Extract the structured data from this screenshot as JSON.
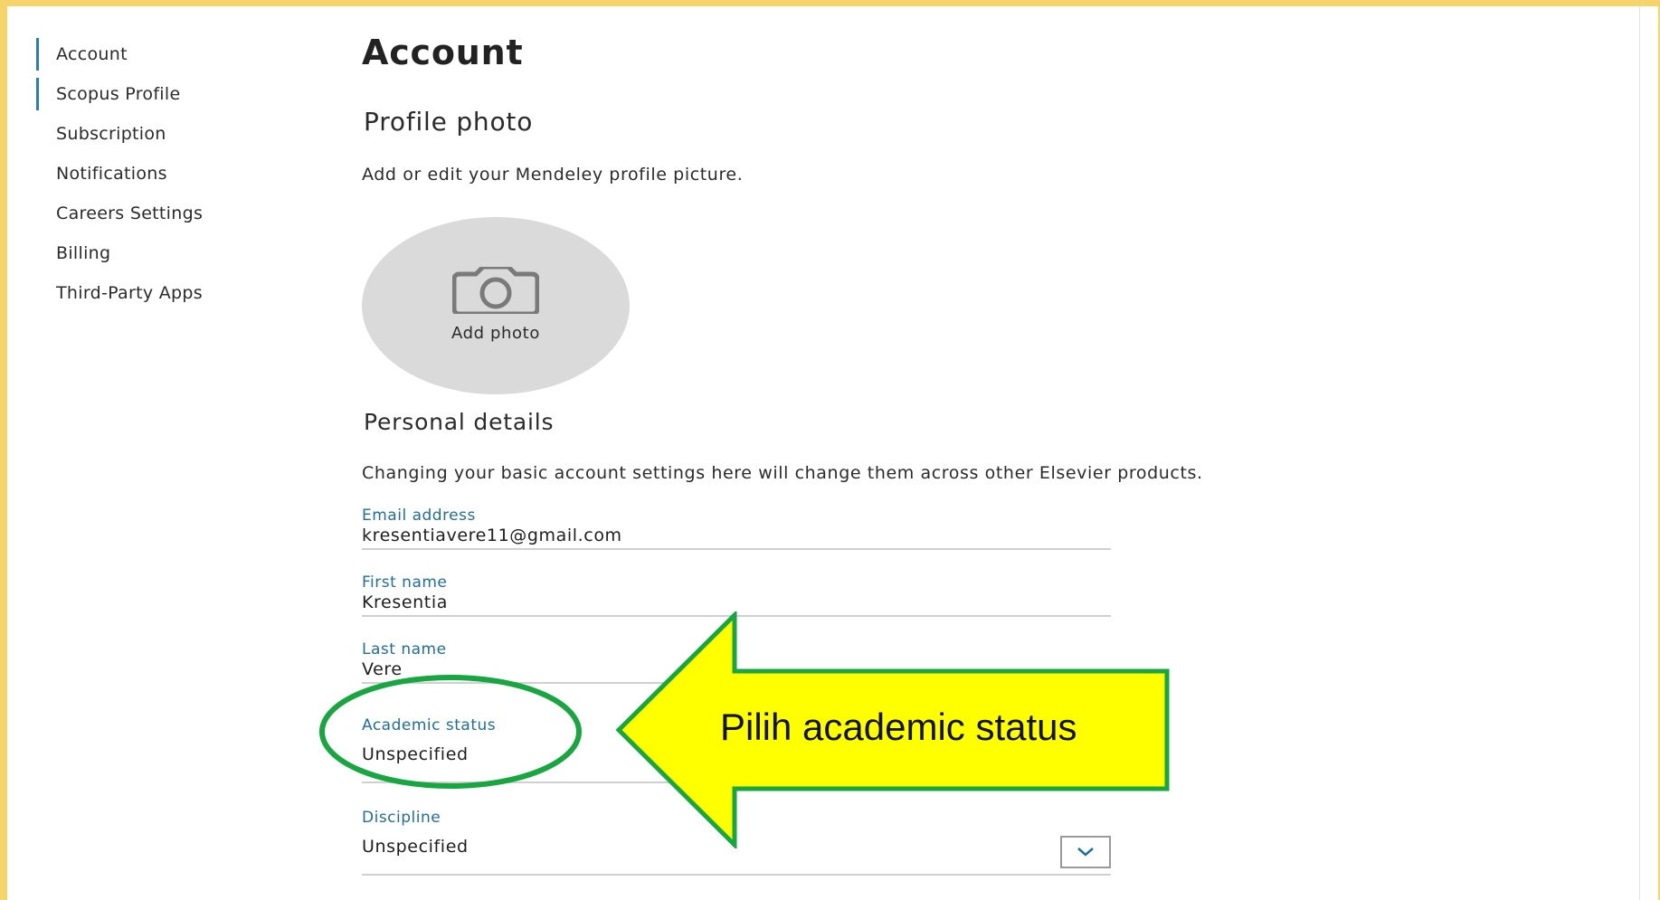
{
  "sidebar": {
    "items": [
      {
        "label": "Account",
        "active": true
      },
      {
        "label": "Scopus Profile",
        "active": true
      },
      {
        "label": "Subscription",
        "active": false
      },
      {
        "label": "Notifications",
        "active": false
      },
      {
        "label": "Careers Settings",
        "active": false
      },
      {
        "label": "Billing",
        "active": false
      },
      {
        "label": "Third-Party Apps",
        "active": false
      }
    ]
  },
  "main": {
    "title": "Account",
    "profile_photo": {
      "heading": "Profile photo",
      "description": "Add or edit your Mendeley profile picture.",
      "add_label": "Add photo",
      "icon": "camera-icon"
    },
    "personal_details": {
      "heading": "Personal details",
      "description": "Changing your basic account settings here will change them across other Elsevier products.",
      "fields": {
        "email": {
          "label": "Email address",
          "value": "kresentiavere11@gmail.com"
        },
        "first_name": {
          "label": "First name",
          "value": "Kresentia"
        },
        "last_name": {
          "label": "Last name",
          "value": "Vere"
        },
        "academic_status": {
          "label": "Academic status",
          "value": "Unspecified"
        },
        "discipline": {
          "label": "Discipline",
          "value": "Unspecified",
          "icon": "chevron-down-icon"
        }
      }
    }
  },
  "annotation": {
    "callout_text": "Pilih academic status",
    "ellipse_color": "#17a640",
    "arrow_fill": "#ffff00",
    "arrow_stroke": "#17a640"
  },
  "colors": {
    "frame": "#f6d36b",
    "accent": "#2a7db5",
    "field_label": "#1f6e9e",
    "photo_bg": "#dadada"
  }
}
